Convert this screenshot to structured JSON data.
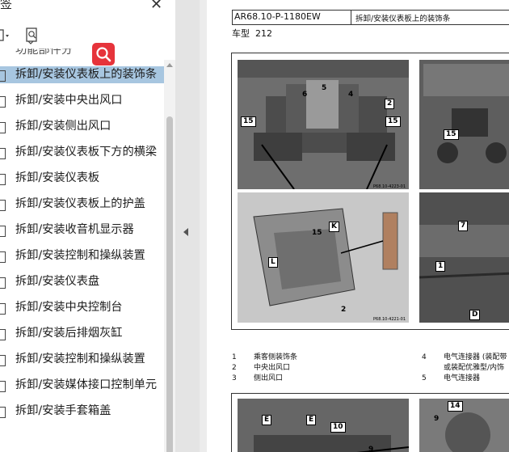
{
  "sidebar": {
    "title": "签",
    "close_label": "✕",
    "toolbar": {
      "expand_icon": "bookmark-options-icon",
      "find_icon": "find-bookmark-icon",
      "search_badge_icon": "search-icon"
    },
    "partial_item": "功能部件分",
    "items": [
      {
        "label": "拆卸/安装仪表板上的装饰条",
        "active": true
      },
      {
        "label": "拆卸/安装中央出风口"
      },
      {
        "label": "拆卸/安装侧出风口"
      },
      {
        "label": "拆卸/安装仪表板下方的横梁"
      },
      {
        "label": "拆卸/安装仪表板"
      },
      {
        "label": "拆卸/安装仪表板上的护盖"
      },
      {
        "label": "拆卸/安装收音机显示器"
      },
      {
        "label": "拆卸/安装控制和操纵装置"
      },
      {
        "label": "拆卸/安装仪表盘"
      },
      {
        "label": "拆卸/安装中央控制台"
      },
      {
        "label": "拆卸/安装后排烟灰缸"
      },
      {
        "label": "拆卸/安装控制和操纵装置"
      },
      {
        "label": "拆卸/安装媒体接口控制单元"
      },
      {
        "label": "拆卸/安装手套箱盖"
      }
    ]
  },
  "document": {
    "code": "AR68.10-P-1180EW",
    "title": "拆卸/安装仪表板上的装饰条",
    "model_label": "车型",
    "model_value": "212",
    "figure1": {
      "tl_labels": [
        "6",
        "5",
        "4",
        "2",
        "15",
        "15"
      ],
      "tl_id": "P68.10-4223-01",
      "tr_labels": [
        "15"
      ],
      "bl_labels": [
        "K",
        "15",
        "L",
        "2"
      ],
      "bl_id": "P68.10-4221-01",
      "br_labels": [
        "7",
        "1",
        "D"
      ]
    },
    "legend": [
      {
        "num": "1",
        "text": "乘客侧装饰条"
      },
      {
        "num": "2",
        "text": "中央出风口"
      },
      {
        "num": "3",
        "text": "侧出风口"
      },
      {
        "num": "4",
        "text": "电气连接器 (装配带"
      },
      {
        "num": "",
        "text": "或装配优雅型/内饰"
      },
      {
        "num": "5",
        "text": "电气连接器"
      }
    ],
    "figure2": {
      "labels": [
        "E",
        "E",
        "10",
        "9",
        "14",
        "9"
      ]
    }
  }
}
